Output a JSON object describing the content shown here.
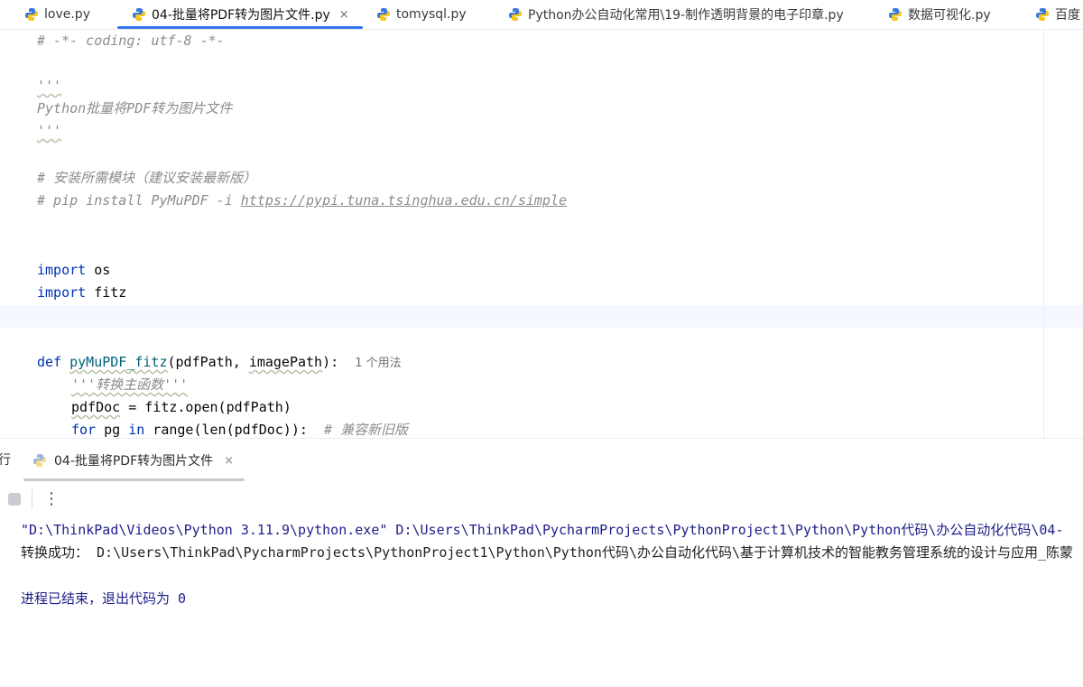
{
  "tabs": [
    {
      "label": "love.py",
      "active": false
    },
    {
      "label": "04-批量将PDF转为图片文件.py",
      "active": true,
      "close": "×"
    },
    {
      "label": "tomysql.py",
      "active": false
    },
    {
      "label": "Python办公自动化常用\\19-制作透明背景的电子印章.py",
      "active": false
    },
    {
      "label": "数据可视化.py",
      "active": false
    },
    {
      "label": "百度",
      "active": false
    }
  ],
  "editor": {
    "line1": "# -*- coding: utf-8 -*-",
    "line3": "'''",
    "line4": "Python批量将PDF转为图片文件",
    "line5": "'''",
    "line7": "# 安装所需模块（建议安装最新版）",
    "line8_prefix": "# pip install PyMuPDF -i ",
    "line8_url": "https://pypi.tuna.tsinghua.edu.cn/simple",
    "import_kw": "import",
    "import1": " os",
    "import2": " fitz",
    "def_kw": "def",
    "func_name": "pyMuPDF_fitz",
    "func_params_pre": "(pdfPath, ",
    "func_params_img": "imagePath",
    "func_params_post": "):",
    "usage_hint": "1 个用法",
    "docstring": "'''转换主函数'''",
    "line_pdfdoc_pre": "pdfDoc",
    "line_pdfdoc_post": " = fitz.open(pdfPath)",
    "for_kw": "for",
    "for_var": " pg ",
    "in_kw": "in",
    "for_range": " range(len(pdfDoc)):",
    "for_comment": "  # 兼容新旧版"
  },
  "run_panel": {
    "label": "行",
    "tab_label": "04-批量将PDF转为图片文件",
    "close": "×",
    "more": "⋮"
  },
  "console": {
    "line1": "\"D:\\ThinkPad\\Videos\\Python 3.11.9\\python.exe\" D:\\Users\\ThinkPad\\PycharmProjects\\PythonProject1\\Python\\Python代码\\办公自动化代码\\04-",
    "line2": "转换成功： D:\\Users\\ThinkPad\\PycharmProjects\\PythonProject1\\Python\\Python代码\\办公自动化代码\\基于计算机技术的智能教务管理系统的设计与应用_陈蒙",
    "line3": "进程已结束，退出代码为 0"
  },
  "colors": {
    "accent": "#3574f0",
    "keyword": "#0033b3",
    "function": "#00627a",
    "comment": "#8c8c8c"
  }
}
